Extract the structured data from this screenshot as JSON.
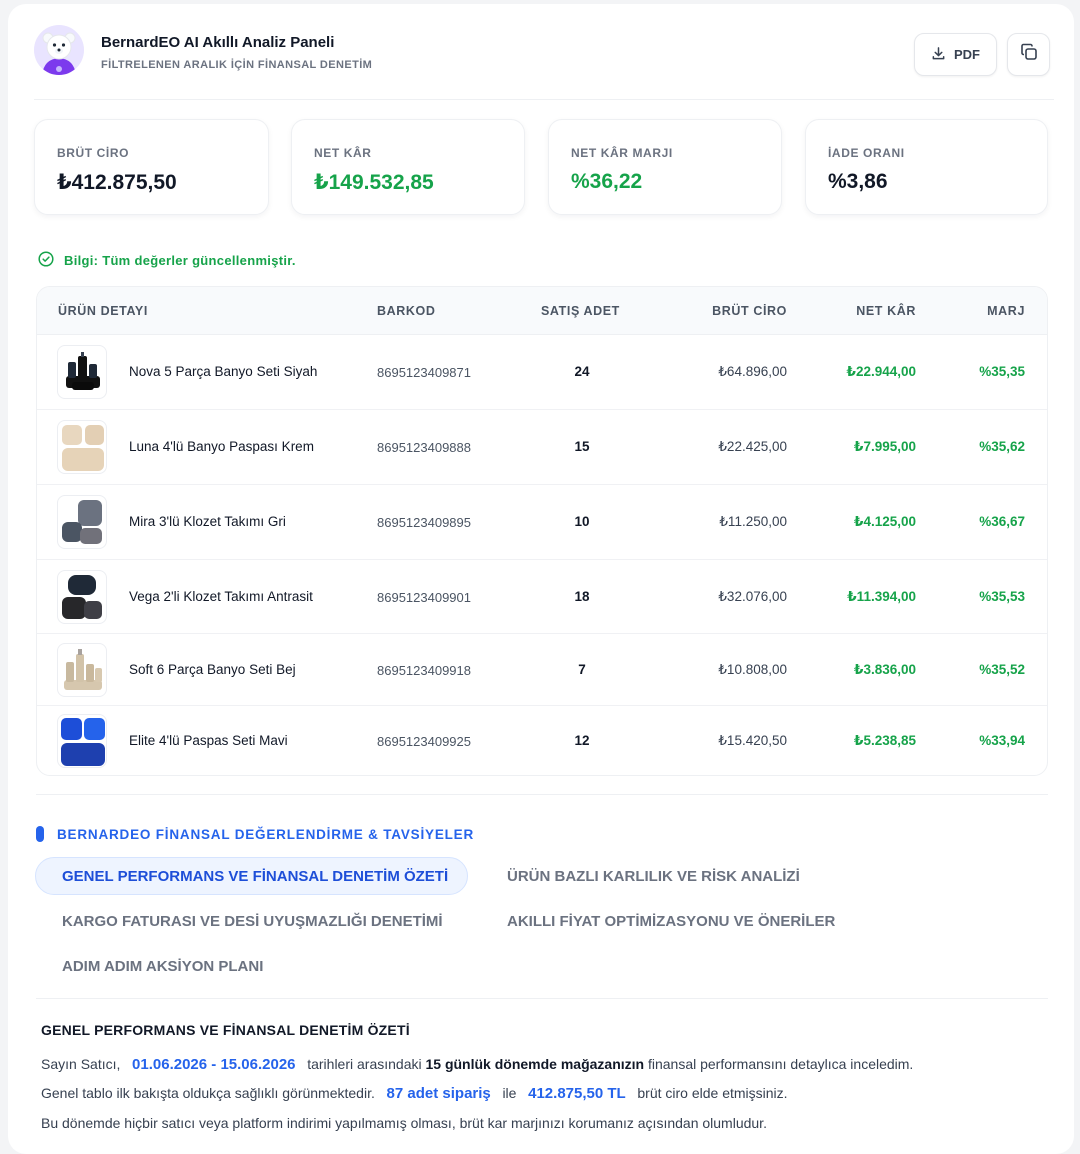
{
  "header": {
    "title": "BernardEO AI Akıllı Analiz Paneli",
    "subtitle": "FİLTRELENEN ARALIK İÇİN FİNANSAL DENETİM",
    "pdf_label": "PDF"
  },
  "stats": [
    {
      "label": "BRÜT CİRO",
      "value": "₺412.875,50"
    },
    {
      "label": "NET KÂR",
      "value": "₺149.532,85"
    },
    {
      "label": "NET KÂR MARJI",
      "value": "%36,22"
    },
    {
      "label": "İADE ORANI",
      "value": "%3,86"
    }
  ],
  "info": "Bilgi: Tüm değerler güncellenmiştir.",
  "table": {
    "headers": {
      "product": "ÜRÜN DETAYI",
      "barcode": "BARKOD",
      "qty": "SATIŞ ADET",
      "revenue": "BRÜT CİRO",
      "profit": "NET KÂR",
      "margin": "MARJ"
    },
    "rows": [
      {
        "name": "Nova 5 Parça Banyo Seti Siyah",
        "barcode": "8695123409871",
        "qty": "24",
        "revenue": "₺64.896,00",
        "profit": "₺22.944,00",
        "margin": "%35,35"
      },
      {
        "name": "Luna 4'lü Banyo Paspası Krem",
        "barcode": "8695123409888",
        "qty": "15",
        "revenue": "₺22.425,00",
        "profit": "₺7.995,00",
        "margin": "%35,62"
      },
      {
        "name": "Mira 3'lü Klozet Takımı Gri",
        "barcode": "8695123409895",
        "qty": "10",
        "revenue": "₺11.250,00",
        "profit": "₺4.125,00",
        "margin": "%36,67"
      },
      {
        "name": "Vega 2'li Klozet Takımı Antrasit",
        "barcode": "8695123409901",
        "qty": "18",
        "revenue": "₺32.076,00",
        "profit": "₺11.394,00",
        "margin": "%35,53"
      },
      {
        "name": "Soft 6 Parça Banyo Seti Bej",
        "barcode": "8695123409918",
        "qty": "7",
        "revenue": "₺10.808,00",
        "profit": "₺3.836,00",
        "margin": "%35,52"
      },
      {
        "name": "Elite 4'lü Paspas Seti Mavi",
        "barcode": "8695123409925",
        "qty": "12",
        "revenue": "₺15.420,50",
        "profit": "₺5.238,85",
        "margin": "%33,94"
      }
    ]
  },
  "section_title": "BERNARDEO FİNANSAL DEĞERLENDİRME & TAVSİYELER",
  "tabs": [
    {
      "label": "GENEL PERFORMANS VE FİNANSAL DENETİM ÖZETİ",
      "active": true
    },
    {
      "label": "ÜRÜN BAZLI KARLILIK VE RİSK ANALİZİ"
    },
    {
      "label": "KARGO FATURASI VE DESİ UYUŞMAZLIĞI DENETİMİ"
    },
    {
      "label": "AKILLI FİYAT OPTİMİZASYONU VE ÖNERİLER"
    },
    {
      "label": "ADIM ADIM AKSİYON PLANI"
    }
  ],
  "summary": {
    "title": "GENEL PERFORMANS VE FİNANSAL DENETİM ÖZETİ",
    "p1_a": "Sayın Satıcı,",
    "p1_date": "01.06.2026 - 15.06.2026",
    "p1_b": "tarihleri arasındaki",
    "p1_bold": "15 günlük dönemde mağazanızın",
    "p1_c": "finansal performansını detaylıca inceledim.",
    "p2_a": "Genel tablo ilk bakışta oldukça sağlıklı görünmektedir.",
    "p2_orders": "87 adet sipariş",
    "p2_b": "ile",
    "p2_amount": "412.875,50 TL",
    "p2_c": "brüt ciro elde etmişsiniz.",
    "p3": "Bu dönemde hiçbir satıcı veya platform indirimi yapılmamış olması, brüt kar marjınızı korumanız açısından olumludur."
  }
}
